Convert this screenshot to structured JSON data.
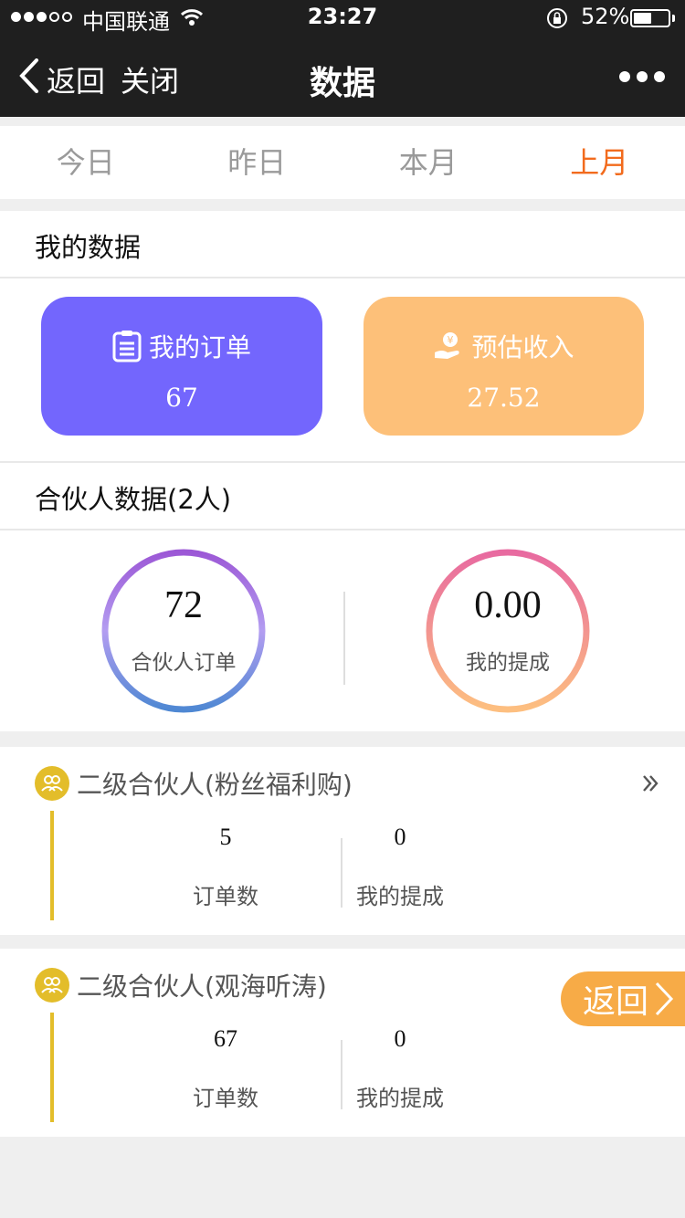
{
  "status_bar": {
    "carrier": "中国联通",
    "time": "23:27",
    "battery_percent": "52%",
    "battery_level": 0.52,
    "signal_bars": 3,
    "signal_total": 5
  },
  "nav": {
    "back_label": "返回",
    "close_label": "关闭",
    "title": "数据",
    "more_icon": "ellipsis-icon"
  },
  "tabs": [
    {
      "label": "今日",
      "active": false
    },
    {
      "label": "昨日",
      "active": false
    },
    {
      "label": "本月",
      "active": false
    },
    {
      "label": "上月",
      "active": true
    }
  ],
  "my_data": {
    "title": "我的数据",
    "orders": {
      "label": "我的订单",
      "value": "67",
      "icon": "clipboard-icon",
      "color": "#7366fd"
    },
    "income": {
      "label": "预估收入",
      "value": "27.52",
      "icon": "coin-hand-icon",
      "color": "#fdc079"
    }
  },
  "partner_data": {
    "title": "合伙人数据(2人)",
    "orders": {
      "value": "72",
      "label": "合伙人订单"
    },
    "commission": {
      "value": "0.00",
      "label": "我的提成"
    }
  },
  "sub_partners": [
    {
      "title": "二级合伙人(粉丝福利购)",
      "orders_value": "5",
      "orders_label": "订单数",
      "commission_value": "0",
      "commission_label": "我的提成"
    },
    {
      "title": "二级合伙人(观海听涛)",
      "orders_value": "67",
      "orders_label": "订单数",
      "commission_value": "0",
      "commission_label": "我的提成"
    }
  ],
  "floating_button": {
    "label": "返回"
  },
  "colors": {
    "accent_active_tab": "#f26b1d",
    "partner_icon": "#e3bd2a",
    "floating_button": "#f7ab47"
  }
}
